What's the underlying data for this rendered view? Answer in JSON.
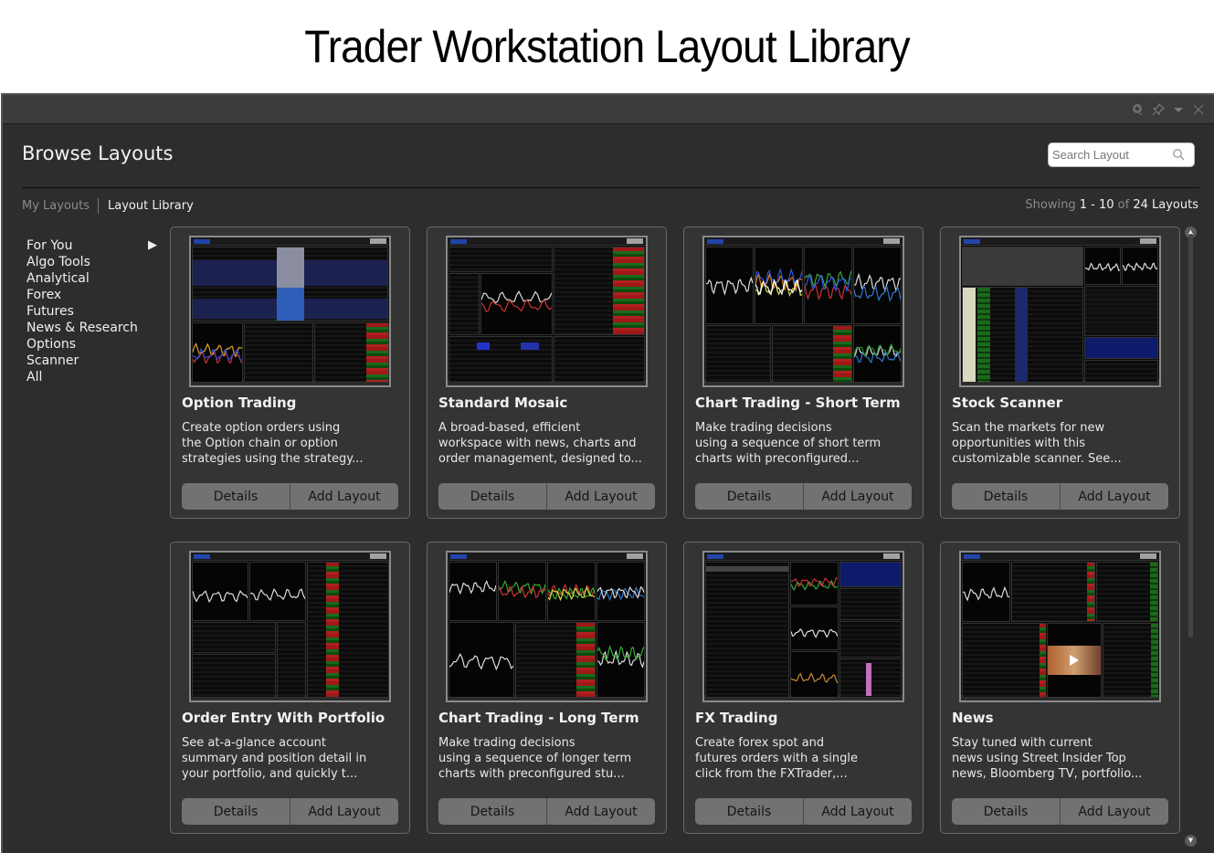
{
  "page_heading": "Trader Workstation Layout Library",
  "window": {
    "title_icons": [
      "chat-icon",
      "pin-icon",
      "dropdown-icon",
      "close-icon"
    ],
    "browse_title": "Browse Layouts",
    "search": {
      "placeholder": "Search Layout",
      "value": ""
    },
    "tabs": [
      {
        "label": "My Layouts",
        "active": false
      },
      {
        "label": "Layout Library",
        "active": true
      }
    ],
    "showing": {
      "prefix": "Showing",
      "from": "1",
      "dash": "-",
      "to": "10",
      "of": "of",
      "total": "24",
      "suffix": "Layouts"
    },
    "categories": [
      {
        "label": "For You",
        "selected": true
      },
      {
        "label": "Algo Tools"
      },
      {
        "label": "Analytical"
      },
      {
        "label": "Forex"
      },
      {
        "label": "Futures"
      },
      {
        "label": "News & Research"
      },
      {
        "label": "Options"
      },
      {
        "label": "Scanner"
      },
      {
        "label": "All"
      }
    ]
  },
  "buttons": {
    "details": "Details",
    "add": "Add Layout"
  },
  "cards": [
    {
      "title": "Option Trading",
      "desc": [
        "Create option orders using",
        "the Option chain or option",
        "strategies using the strategy..."
      ],
      "thumb": "option"
    },
    {
      "title": "Standard Mosaic",
      "desc": [
        "A broad-based, efficient",
        "workspace with news, charts and",
        "order management, designed to..."
      ],
      "thumb": "mosaic"
    },
    {
      "title": "Chart Trading - Short Term",
      "desc": [
        "Make trading decisions",
        "using a sequence of short term",
        "charts with preconfigured..."
      ],
      "thumb": "charts-short"
    },
    {
      "title": "Stock Scanner",
      "desc": [
        "Scan the markets for new",
        "opportunities with this",
        "customizable scanner. See..."
      ],
      "thumb": "scanner"
    },
    {
      "title": "Order Entry With Portfolio",
      "desc": [
        "See at-a-glance account",
        "summary and position detail in",
        "your portfolio, and quickly t..."
      ],
      "thumb": "portfolio"
    },
    {
      "title": "Chart Trading - Long Term",
      "desc": [
        "Make trading decisions",
        "using a sequence of longer term",
        "charts with preconfigured stu..."
      ],
      "thumb": "charts-long"
    },
    {
      "title": "FX Trading",
      "desc": [
        "Create forex spot and",
        "futures orders with a single",
        "click from the FXTrader,..."
      ],
      "thumb": "fx"
    },
    {
      "title": "News",
      "desc": [
        "Stay tuned with current",
        "news using Street Insider Top",
        "news, Bloomberg TV, portfolio..."
      ],
      "thumb": "news"
    }
  ]
}
